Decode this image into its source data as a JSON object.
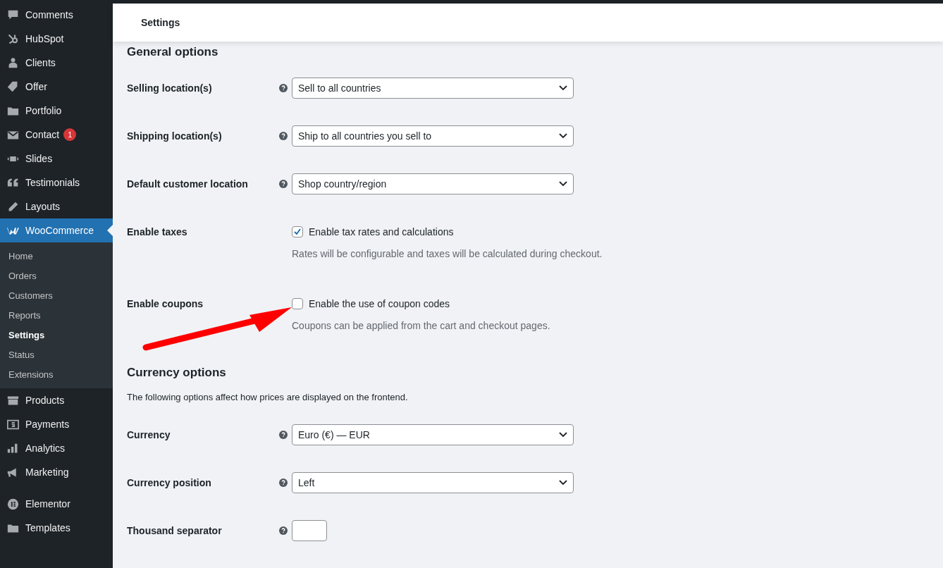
{
  "sidebar": {
    "items": [
      {
        "label": "Comments",
        "selected": false
      },
      {
        "label": "HubSpot",
        "selected": false
      },
      {
        "label": "Clients",
        "selected": false
      },
      {
        "label": "Offer",
        "selected": false
      },
      {
        "label": "Portfolio",
        "selected": false
      },
      {
        "label": "Contact",
        "selected": false,
        "badge": "1"
      },
      {
        "label": "Slides",
        "selected": false
      },
      {
        "label": "Testimonials",
        "selected": false
      },
      {
        "label": "Layouts",
        "selected": false
      },
      {
        "label": "WooCommerce",
        "selected": true,
        "children": [
          {
            "label": "Home",
            "selected": false
          },
          {
            "label": "Orders",
            "selected": false
          },
          {
            "label": "Customers",
            "selected": false
          },
          {
            "label": "Reports",
            "selected": false
          },
          {
            "label": "Settings",
            "selected": true
          },
          {
            "label": "Status",
            "selected": false
          },
          {
            "label": "Extensions",
            "selected": false
          }
        ]
      },
      {
        "label": "Products",
        "selected": false
      },
      {
        "label": "Payments",
        "selected": false
      },
      {
        "label": "Analytics",
        "selected": false
      },
      {
        "label": "Marketing",
        "selected": false
      },
      {
        "label": "Elementor",
        "selected": false
      },
      {
        "label": "Templates",
        "selected": false
      }
    ]
  },
  "header": {
    "title": "Settings"
  },
  "sections": [
    {
      "heading": "General options",
      "rows": [
        {
          "kind": "select",
          "label": "Selling location(s)",
          "help": true,
          "value": "Sell to all countries"
        },
        {
          "kind": "select",
          "label": "Shipping location(s)",
          "help": true,
          "value": "Ship to all countries you sell to"
        },
        {
          "kind": "select",
          "label": "Default customer location",
          "help": true,
          "value": "Shop country/region"
        },
        {
          "kind": "checkbox",
          "label": "Enable taxes",
          "help": false,
          "option": "Enable tax rates and calculations",
          "checked": true,
          "description": "Rates will be configurable and taxes will be calculated during checkout."
        },
        {
          "kind": "checkbox",
          "label": "Enable coupons",
          "help": false,
          "option": "Enable the use of coupon codes",
          "checked": false,
          "description": "Coupons can be applied from the cart and checkout pages."
        }
      ]
    },
    {
      "heading": "Currency options",
      "description": "The following options affect how prices are displayed on the frontend.",
      "rows": [
        {
          "kind": "select",
          "label": "Currency",
          "help": true,
          "value": "Euro (€) — EUR"
        },
        {
          "kind": "select",
          "label": "Currency position",
          "help": true,
          "value": "Left"
        },
        {
          "kind": "text",
          "label": "Thousand separator",
          "help": true
        }
      ]
    }
  ]
}
